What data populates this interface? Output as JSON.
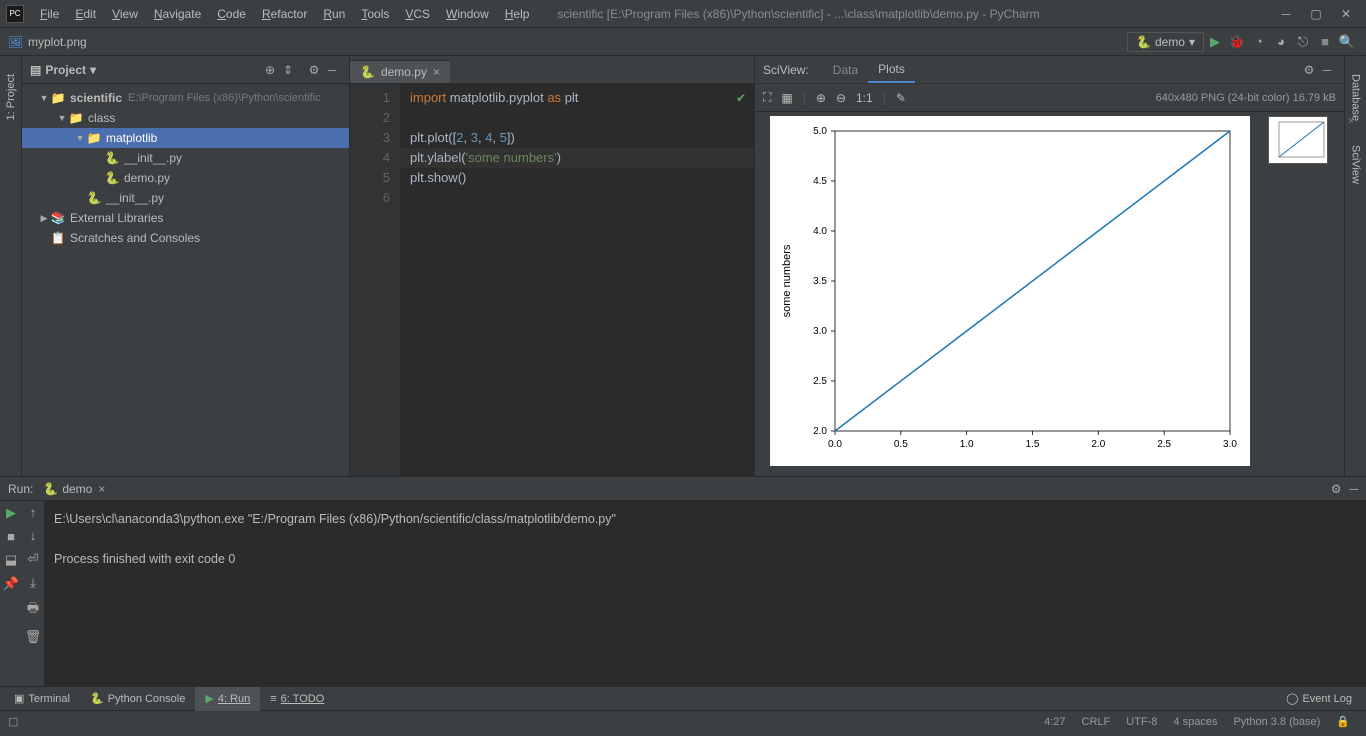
{
  "app": {
    "logo_text": "PC",
    "title": "scientific [E:\\Program Files (x86)\\Python\\scientific] - ...\\class\\matplotlib\\demo.py - PyCharm"
  },
  "menu": [
    "File",
    "Edit",
    "View",
    "Navigate",
    "Code",
    "Refactor",
    "Run",
    "Tools",
    "VCS",
    "Window",
    "Help"
  ],
  "breadcrumb": {
    "file": "myplot.png"
  },
  "run_config": {
    "label": "demo"
  },
  "left_tabs": {
    "project": "1: Project"
  },
  "right_tabs": {
    "database": "Database",
    "sciview": "SciView"
  },
  "project": {
    "title": "Project",
    "tree": [
      {
        "d": 0,
        "a": "▼",
        "icon": "📁",
        "text": "scientific",
        "hint": "E:\\Program Files (x86)\\Python\\scientific",
        "bold": true
      },
      {
        "d": 1,
        "a": "▼",
        "icon": "📁",
        "text": "class"
      },
      {
        "d": 2,
        "a": "▼",
        "icon": "📁",
        "text": "matplotlib",
        "sel": true
      },
      {
        "d": 3,
        "a": "",
        "icon": "🐍",
        "text": "__init__.py"
      },
      {
        "d": 3,
        "a": "",
        "icon": "🐍",
        "text": "demo.py"
      },
      {
        "d": 2,
        "a": "",
        "icon": "🐍",
        "text": "__init__.py"
      },
      {
        "d": 0,
        "a": "▶",
        "icon": "📚",
        "text": "External Libraries"
      },
      {
        "d": 0,
        "a": "",
        "icon": "📋",
        "text": "Scratches and Consoles"
      }
    ]
  },
  "editor": {
    "tab": "demo.py",
    "lines": [
      "1",
      "2",
      "3",
      "4",
      "5",
      "6"
    ]
  },
  "sciview": {
    "label": "SciView:",
    "tabs": {
      "data": "Data",
      "plots": "Plots"
    },
    "info": "640x480 PNG (24-bit color) 16.79 kB",
    "oneToOne": "1:1"
  },
  "chart_data": {
    "type": "line",
    "x": [
      0.0,
      1.0,
      2.0,
      3.0
    ],
    "values": [
      2.0,
      3.0,
      4.0,
      5.0
    ],
    "ylabel": "some numbers",
    "xlabel": "",
    "title": "",
    "x_ticks": [
      0.0,
      0.5,
      1.0,
      1.5,
      2.0,
      2.5,
      3.0
    ],
    "y_ticks": [
      2.0,
      2.5,
      3.0,
      3.5,
      4.0,
      4.5,
      5.0
    ],
    "xlim": [
      0.0,
      3.0
    ],
    "ylim": [
      2.0,
      5.0
    ]
  },
  "run": {
    "title": "Run:",
    "tab": "demo",
    "line1": "E:\\Users\\cl\\anaconda3\\python.exe \"E:/Program Files (x86)/Python/scientific/class/matplotlib/demo.py\"",
    "line2": "Process finished with exit code 0"
  },
  "bottom_tabs": {
    "terminal": "Terminal",
    "pyconsole": "Python Console",
    "run": "4: Run",
    "todo": "6: TODO",
    "eventlog": "Event Log"
  },
  "status": {
    "pos": "4:27",
    "crlf": "CRLF",
    "enc": "UTF-8",
    "indent": "4 spaces",
    "py": "Python 3.8 (base)"
  }
}
